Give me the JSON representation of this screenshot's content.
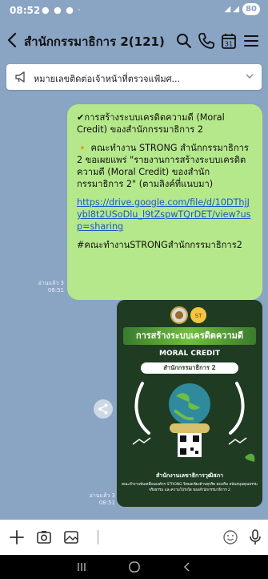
{
  "status": {
    "time": "08:52",
    "battery": "80"
  },
  "header": {
    "title": "สำนักกรรมาธิการ 2(121)"
  },
  "announcement": {
    "text": "หมายเลขติดต่อเจ้าหน้าที่ตรวจแฟ้มศ..."
  },
  "message": {
    "para1": "✔การสร้างระบบเครดิตความดี (Moral Credit) ของสำนักกรรมาธิการ 2",
    "para2": "🔸 คณะทำงาน STRONG สำนักกรรมาธิการ 2 ขอเผยแพร่ \"รายงานการสร้างระบบเครดิตความดี (Moral Credit) ของสำนักกรรมาธิการ 2\" (ตามลิงค์ที่แนบมา)",
    "link": "https://drive.google.com/file/d/10DThjJybl8t2USoDlu_l9tZspwTQrDET/view?usp=sharing",
    "hashtag": "#คณะทำงานSTRONGสำนักกรรมาธิการ2",
    "read": "อ่านแล้ว 3",
    "time": "08:51"
  },
  "poster": {
    "badge": "ST",
    "title": "การสร้างระบบเครดิตความดี",
    "subtitle": "MORAL CREDIT",
    "pill": "สำนักกรรมาธิการ 2",
    "org": "สำนักงานเลขาธิการวุฒิสภา",
    "desc": "คณะทำงานขับเคลื่อนองค์กร STRONG จิตพอเพียงต้านทุจริต ส่งเสริม สนับสนุนคุณธรรม จริยธรรม และความโปร่งใส ของสำนักกรรมาธิการ 2",
    "read": "อ่านแล้ว 3",
    "time": "08:51"
  },
  "colors": {
    "chat_bg": "#8aa4c4",
    "bubble": "#b5e88b",
    "link": "#1d57c9"
  }
}
